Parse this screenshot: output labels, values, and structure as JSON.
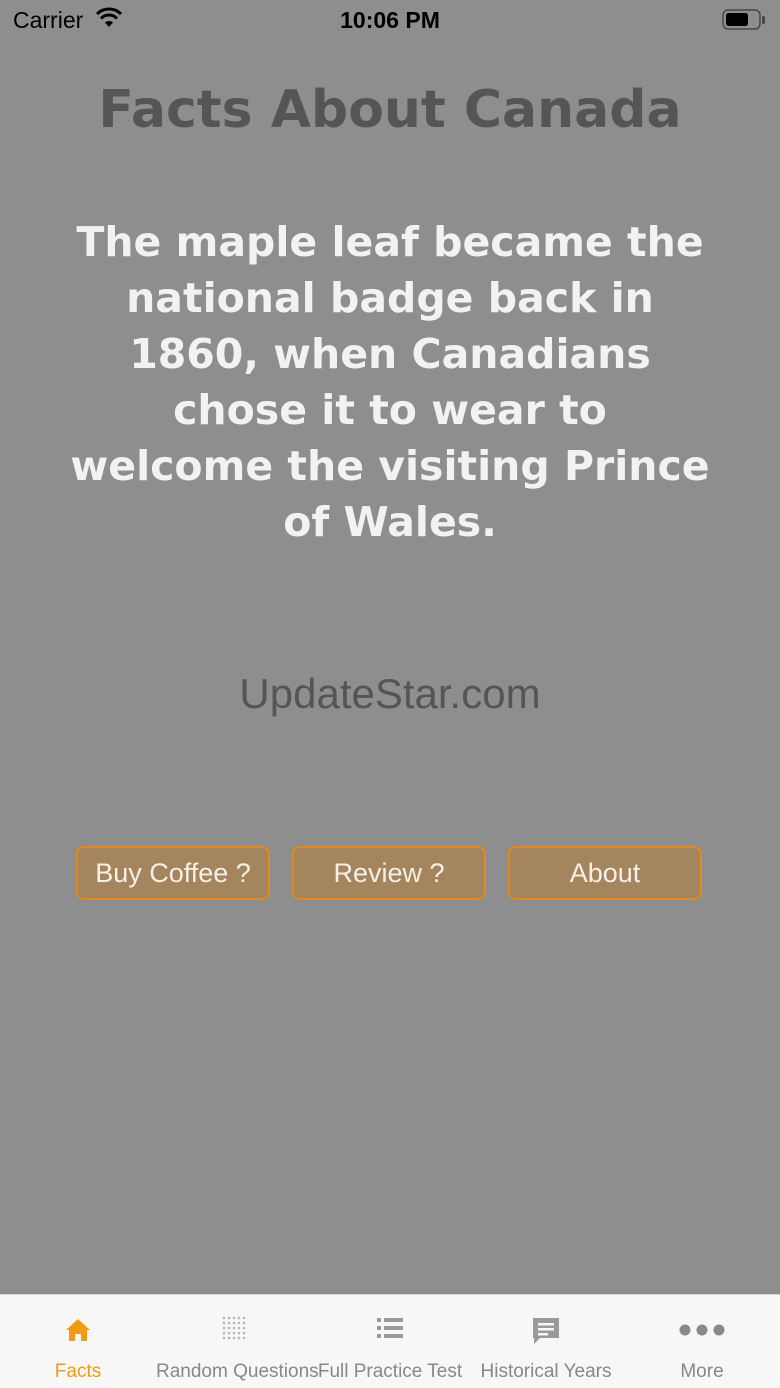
{
  "status_bar": {
    "carrier": "Carrier",
    "time": "10:06 PM"
  },
  "title": "Facts About Canada",
  "fact_text": "The maple leaf became the national badge back in 1860, when Canadians chose it to wear to welcome the visiting Prince of Wales.",
  "watermark": "UpdateStar.com",
  "buttons": {
    "buy_coffee": "Buy Coffee ?",
    "review": "Review ?",
    "about": "About"
  },
  "tabs": [
    {
      "label": "Facts",
      "icon": "home-icon",
      "active": true
    },
    {
      "label": "Random Questions",
      "icon": "grid-dots-icon",
      "active": false
    },
    {
      "label": "Full  Practice Test",
      "icon": "list-icon",
      "active": false
    },
    {
      "label": "Historical Years",
      "icon": "chat-bubble-icon",
      "active": false
    },
    {
      "label": "More",
      "icon": "more-dots-icon",
      "active": false
    }
  ],
  "colors": {
    "background": "#8e8e8e",
    "accent": "#f29a14",
    "button_fill": "#a4855e",
    "button_border": "#e08a1e"
  }
}
